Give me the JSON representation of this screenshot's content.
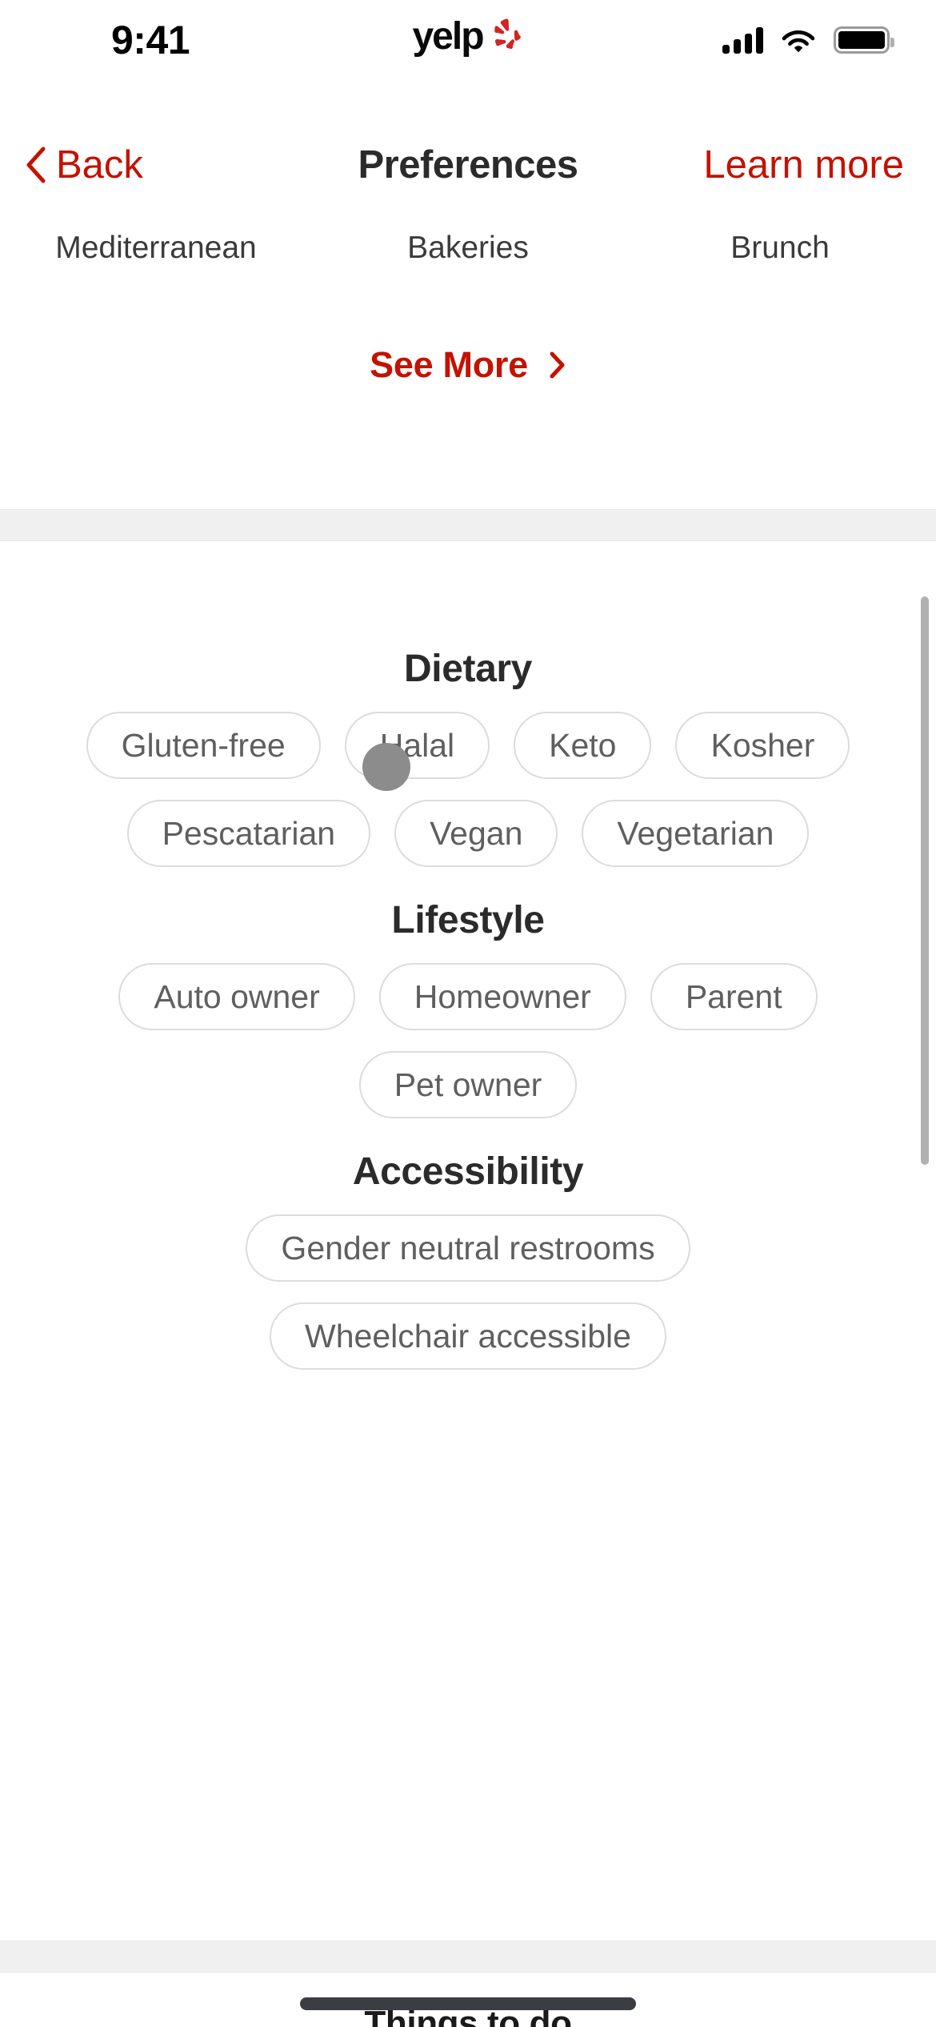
{
  "status_bar": {
    "time": "9:41",
    "brand": "yelp",
    "icons": {
      "signal": "signal-bars-icon",
      "wifi": "wifi-icon",
      "battery": "battery-full-icon"
    }
  },
  "nav": {
    "back_label": "Back",
    "title": "Preferences",
    "learn_more_label": "Learn more",
    "back_icon": "chevron-left-icon"
  },
  "top_categories": [
    "Mediterranean",
    "Bakeries",
    "Brunch"
  ],
  "see_more": {
    "label": "See More",
    "icon": "chevron-right-icon"
  },
  "sections": [
    {
      "id": "dietary",
      "title": "Dietary",
      "rows": [
        [
          "Gluten-free",
          "Halal",
          "Keto",
          "Kosher"
        ],
        [
          "Pescatarian",
          "Vegan",
          "Vegetarian"
        ]
      ]
    },
    {
      "id": "lifestyle",
      "title": "Lifestyle",
      "rows": [
        [
          "Auto owner",
          "Homeowner",
          "Parent"
        ],
        [
          "Pet owner"
        ]
      ]
    },
    {
      "id": "accessibility",
      "title": "Accessibility",
      "rows": [
        [
          "Gender neutral restrooms"
        ],
        [
          "Wheelchair accessible"
        ]
      ]
    }
  ],
  "bottom": {
    "partial_label": "Things to do"
  },
  "colors": {
    "brand_red": "#C41200",
    "chip_border": "#dcdcdc",
    "chip_text": "#5f5f5f",
    "heading": "#2b2b2b",
    "band": "#f1f0f1",
    "scrollbar": "#b1b1b1",
    "cursor": "#8c8c8c"
  }
}
